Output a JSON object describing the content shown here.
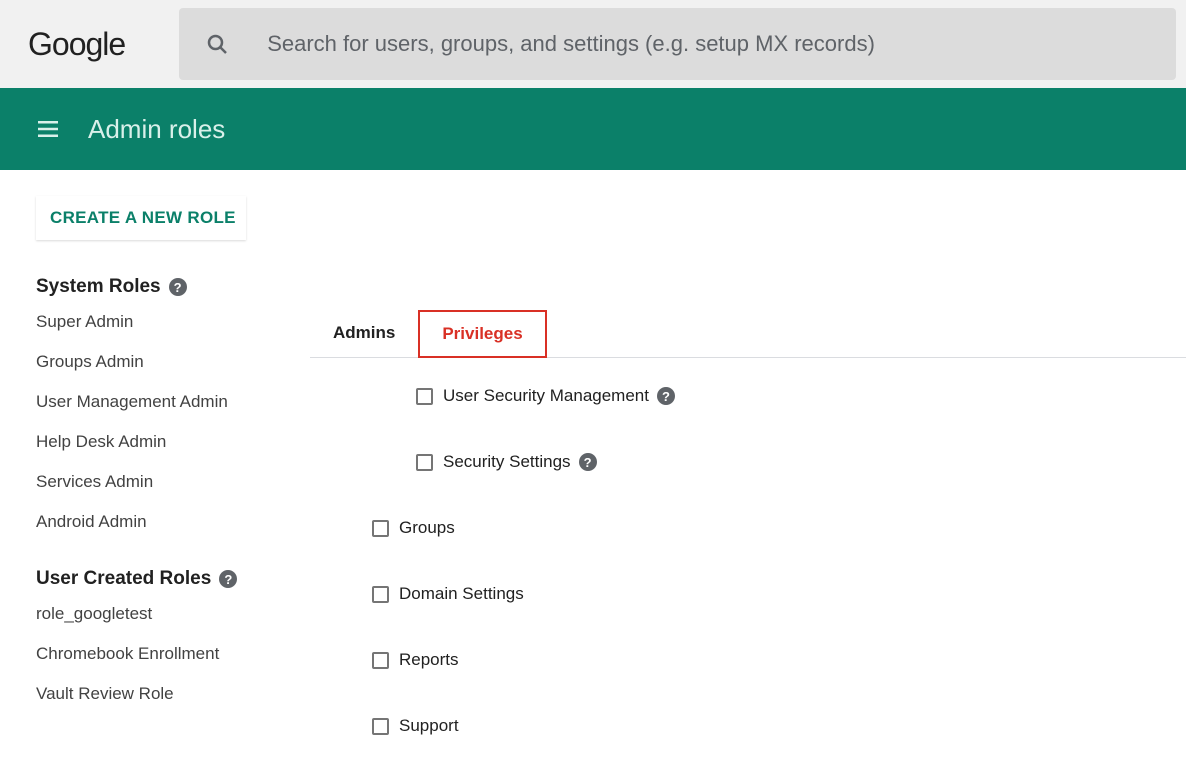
{
  "header": {
    "logo": "Google",
    "search_placeholder": "Search for users, groups, and settings (e.g. setup MX records)"
  },
  "banner": {
    "title": "Admin roles"
  },
  "sidebar": {
    "create_label": "CREATE A NEW ROLE",
    "system_roles_title": "System Roles",
    "system_roles": [
      "Super Admin",
      "Groups Admin",
      "User Management Admin",
      "Help Desk Admin",
      "Services Admin",
      "Android Admin"
    ],
    "user_roles_title": "User Created Roles",
    "user_roles": [
      "role_googletest",
      "Chromebook Enrollment",
      "Vault Review Role"
    ]
  },
  "tabs": {
    "admins": "Admins",
    "privileges": "Privileges"
  },
  "privileges": [
    {
      "label": "User Security Management",
      "indent": 1,
      "help": true
    },
    {
      "label": "Security Settings",
      "indent": 1,
      "help": true
    },
    {
      "label": "Groups",
      "indent": 0,
      "help": false
    },
    {
      "label": "Domain Settings",
      "indent": 0,
      "help": false
    },
    {
      "label": "Reports",
      "indent": 0,
      "help": false
    },
    {
      "label": "Support",
      "indent": 0,
      "help": false
    }
  ]
}
